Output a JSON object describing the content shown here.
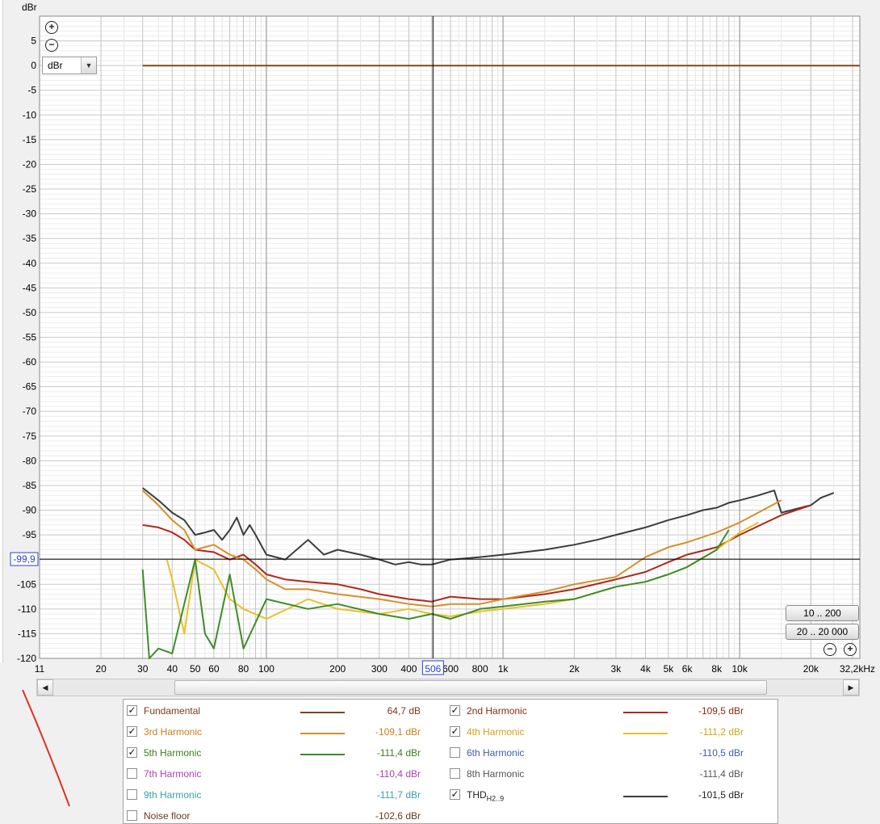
{
  "chart_data": {
    "type": "line",
    "title": "",
    "ylabel": "dBr",
    "xlabel": "",
    "x_scale": "log",
    "xlim": [
      11,
      32200
    ],
    "ylim": [
      -120,
      10
    ],
    "x_tick_labels": [
      "11",
      "20",
      "30",
      "40",
      "50",
      "60",
      "80",
      "100",
      "200",
      "300",
      "400",
      "600",
      "800",
      "1k",
      "2k",
      "3k",
      "4k",
      "5k",
      "6k",
      "8k",
      "10k",
      "20k",
      "32,2kHz"
    ],
    "x_tick_values": [
      11,
      20,
      30,
      40,
      50,
      60,
      80,
      100,
      200,
      300,
      400,
      600,
      800,
      1000,
      2000,
      3000,
      4000,
      5000,
      6000,
      8000,
      10000,
      20000,
      32200
    ],
    "y_tick_labels": [
      "5",
      "0",
      "-5",
      "-10",
      "-15",
      "-20",
      "-25",
      "-30",
      "-35",
      "-40",
      "-45",
      "-50",
      "-55",
      "-60",
      "-65",
      "-70",
      "-75",
      "-80",
      "-85",
      "-90",
      "-95",
      "-105",
      "-110",
      "-115",
      "-120"
    ],
    "y_tick_values": [
      5,
      0,
      -5,
      -10,
      -15,
      -20,
      -25,
      -30,
      -35,
      -40,
      -45,
      -50,
      -55,
      -60,
      -65,
      -70,
      -75,
      -80,
      -85,
      -90,
      -95,
      -105,
      -110,
      -115,
      -120
    ],
    "cursor": {
      "x": 506,
      "y": -99.9,
      "x_label": "506",
      "y_label": "-99,9"
    },
    "grid": true,
    "series": [
      {
        "name": "Fundamental",
        "color": "#7a4a1e",
        "x": [
          30,
          32200
        ],
        "y": [
          0,
          0
        ]
      },
      {
        "name": "THD",
        "color": "#3c3c3c",
        "x": [
          30,
          35,
          40,
          45,
          50,
          55,
          60,
          65,
          70,
          75,
          80,
          85,
          90,
          100,
          120,
          150,
          175,
          200,
          250,
          300,
          350,
          400,
          450,
          500,
          600,
          800,
          1000,
          1500,
          2000,
          2500,
          3000,
          4000,
          5000,
          6000,
          7000,
          8000,
          9000,
          10000,
          12000,
          14000,
          15000,
          20000,
          22000,
          25000
        ],
        "y": [
          -85.5,
          -88,
          -90.5,
          -92,
          -95,
          -94.5,
          -94,
          -96,
          -94,
          -91.5,
          -95,
          -93,
          -95,
          -99,
          -100,
          -96,
          -99,
          -98,
          -99,
          -100,
          -101,
          -100.5,
          -101,
          -101,
          -100,
          -99.5,
          -99,
          -98,
          -97,
          -96,
          -95,
          -93.5,
          -92,
          -91,
          -90,
          -89.5,
          -88.5,
          -88,
          -87,
          -86,
          -90.5,
          -89,
          -87.5,
          -86.5
        ]
      },
      {
        "name": "2nd Harmonic",
        "color": "#b0281a",
        "x": [
          30,
          35,
          40,
          45,
          50,
          60,
          70,
          80,
          90,
          100,
          120,
          150,
          200,
          250,
          300,
          400,
          500,
          600,
          800,
          1000,
          1500,
          2000,
          3000,
          4000,
          5000,
          6000,
          8000,
          10000,
          15000,
          20000
        ],
        "y": [
          -93,
          -93.5,
          -94.5,
          -96,
          -98,
          -98.5,
          -100,
          -99,
          -101,
          -103,
          -104,
          -104.5,
          -105,
          -106,
          -107,
          -108,
          -108.5,
          -107.5,
          -108,
          -108,
          -107,
          -106,
          -104,
          -102.5,
          -100.5,
          -99,
          -97.5,
          -95,
          -91,
          -89
        ]
      },
      {
        "name": "3rd Harmonic",
        "color": "#d4902a",
        "x": [
          30,
          35,
          40,
          45,
          50,
          60,
          70,
          80,
          90,
          100,
          120,
          150,
          200,
          300,
          400,
          500,
          600,
          800,
          1000,
          1500,
          2000,
          3000,
          4000,
          5000,
          6000,
          8000,
          10000,
          15000
        ],
        "y": [
          -86,
          -89,
          -92,
          -94,
          -98,
          -97,
          -99,
          -100,
          -102,
          -104,
          -106,
          -106,
          -107,
          -108,
          -109,
          -109.5,
          -109,
          -109,
          -108,
          -106.5,
          -105,
          -103.5,
          -99.5,
          -97.5,
          -96.5,
          -94.5,
          -92.5,
          -88
        ]
      },
      {
        "name": "4th Harmonic",
        "color": "#e6c22a",
        "x": [
          38,
          40,
          45,
          50,
          60,
          70,
          80,
          100,
          150,
          200,
          300,
          400,
          500,
          600,
          800,
          1000,
          1500,
          2000,
          3000,
          4000,
          5000,
          6000,
          8000,
          10000,
          12000
        ],
        "y": [
          -100,
          -104,
          -115,
          -100,
          -102,
          -108,
          -110,
          -112,
          -108,
          -110,
          -111,
          -110,
          -111,
          -111.5,
          -110.5,
          -110,
          -109,
          -108,
          -105.5,
          -104.5,
          -103,
          -101.5,
          -98,
          -94.5,
          -92.5
        ]
      },
      {
        "name": "5th Harmonic",
        "color": "#3f8c2a",
        "x": [
          30,
          32,
          35,
          40,
          50,
          55,
          60,
          70,
          80,
          100,
          150,
          200,
          300,
          400,
          500,
          600,
          800,
          1000,
          1500,
          2000,
          3000,
          4000,
          5000,
          6000,
          8000,
          9000
        ],
        "y": [
          -102,
          -120,
          -118,
          -119,
          -100,
          -115,
          -118,
          -103,
          -118,
          -108,
          -110,
          -109,
          -111,
          -112,
          -111,
          -112,
          -110,
          -109.5,
          -108.5,
          -108,
          -105.5,
          -104.5,
          -103,
          -101.5,
          -98,
          -94
        ]
      }
    ]
  },
  "unit_label": "dBr",
  "unit_select": "dBr",
  "cursor_x_readout": "506",
  "cursor_y_readout": "-99,9",
  "range_buttons": [
    "10 .. 200",
    "20 .. 20 000"
  ],
  "legend": [
    {
      "name": "Fundamental",
      "checked": true,
      "color": "#7a4a1e",
      "value": "64,7 dB",
      "show_line": true,
      "label_color": "#7a3a1a"
    },
    {
      "name": "2nd Harmonic",
      "checked": true,
      "color": "#b0281a",
      "value": "-109,5 dBr",
      "show_line": true,
      "label_color": "#8a2a14"
    },
    {
      "name": "3rd Harmonic",
      "checked": true,
      "color": "#d4902a",
      "value": "-109,1 dBr",
      "show_line": true,
      "label_color": "#c8801c"
    },
    {
      "name": "4th Harmonic",
      "checked": true,
      "color": "#e6c22a",
      "value": "-111,2 dBr",
      "show_line": true,
      "label_color": "#caa61c"
    },
    {
      "name": "5th Harmonic",
      "checked": true,
      "color": "#3f8c2a",
      "value": "-111,4 dBr",
      "show_line": true,
      "label_color": "#3a7d22"
    },
    {
      "name": "6th Harmonic",
      "checked": false,
      "color": "#3b5fa8",
      "value": "-110,5 dBr",
      "show_line": false,
      "label_color": "#3b5fa8"
    },
    {
      "name": "7th Harmonic",
      "checked": false,
      "color": "#b040b0",
      "value": "-110,4 dBr",
      "show_line": false,
      "label_color": "#b040b0"
    },
    {
      "name": "8th Harmonic",
      "checked": false,
      "color": "#555555",
      "value": "-111,4 dBr",
      "show_line": false,
      "label_color": "#555555"
    },
    {
      "name": "9th Harmonic",
      "checked": false,
      "color": "#3aa0a8",
      "value": "-111,7 dBr",
      "show_line": false,
      "label_color": "#3aa0a8"
    },
    {
      "name": "THD",
      "sub": "H2..9",
      "checked": true,
      "color": "#3c3c3c",
      "value": "-101,5 dBr",
      "show_line": true,
      "label_color": "#222222"
    },
    {
      "name": "Noise floor",
      "checked": false,
      "color": "#555555",
      "value": "-102,6 dBr",
      "show_line": false,
      "label_color": "#6a3a1a"
    }
  ]
}
